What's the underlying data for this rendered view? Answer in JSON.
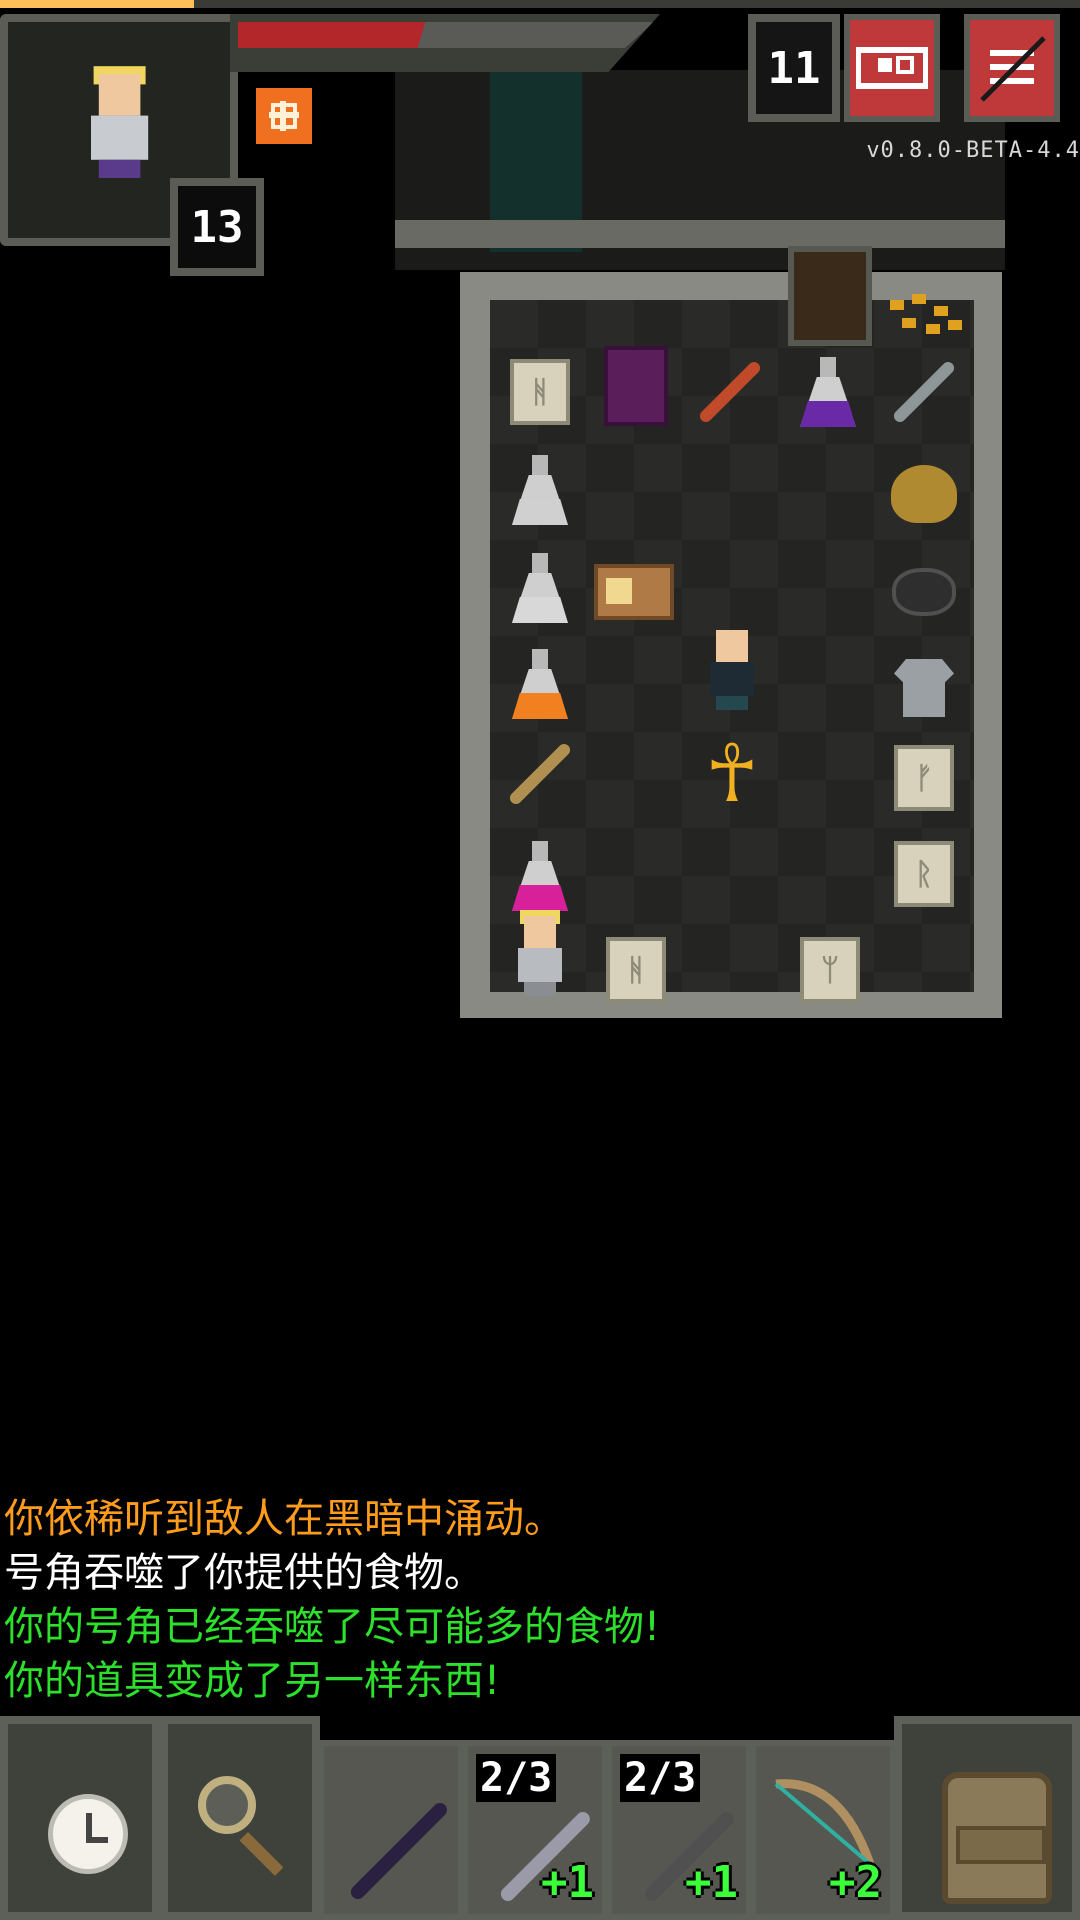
{
  "hud": {
    "hero_level": "13",
    "depth": "11",
    "version": "v0.8.0-BETA-4.4",
    "icons": {
      "journal": "journal-icon",
      "menu": "menu-icon",
      "buff": "buff-icon"
    }
  },
  "status": {
    "hp_fraction": 0.45,
    "xp_fraction": 0.18
  },
  "log": [
    {
      "text": "你依稀听到敌人在黑暗中涌动。",
      "color": "#ff9c1c"
    },
    {
      "text": "号角吞噬了你提供的食物。",
      "color": "#ffffff"
    },
    {
      "text": "你的号角已经吞噬了尽可能多的食物!",
      "color": "#2ce02c"
    },
    {
      "text": "你的道具变成了另一样东西!",
      "color": "#2ce02c"
    }
  ],
  "toolbar": {
    "wait_icon": "clock-icon",
    "search_icon": "magnifier-icon",
    "backpack_icon": "backpack-icon",
    "quickslots": [
      {
        "item": "dark-wand",
        "charges": "",
        "upgrade": ""
      },
      {
        "item": "wand",
        "charges": "2/3",
        "upgrade": "+1"
      },
      {
        "item": "wand",
        "charges": "2/3",
        "upgrade": "+1"
      },
      {
        "item": "bow",
        "charges": "",
        "upgrade": "+2"
      }
    ]
  },
  "colors": {
    "hp": "#b3262a",
    "xp": "#ffc05a",
    "log_warning": "#ff9c1c",
    "log_positive": "#2ce02c",
    "upgrade": "#3bff3b"
  }
}
